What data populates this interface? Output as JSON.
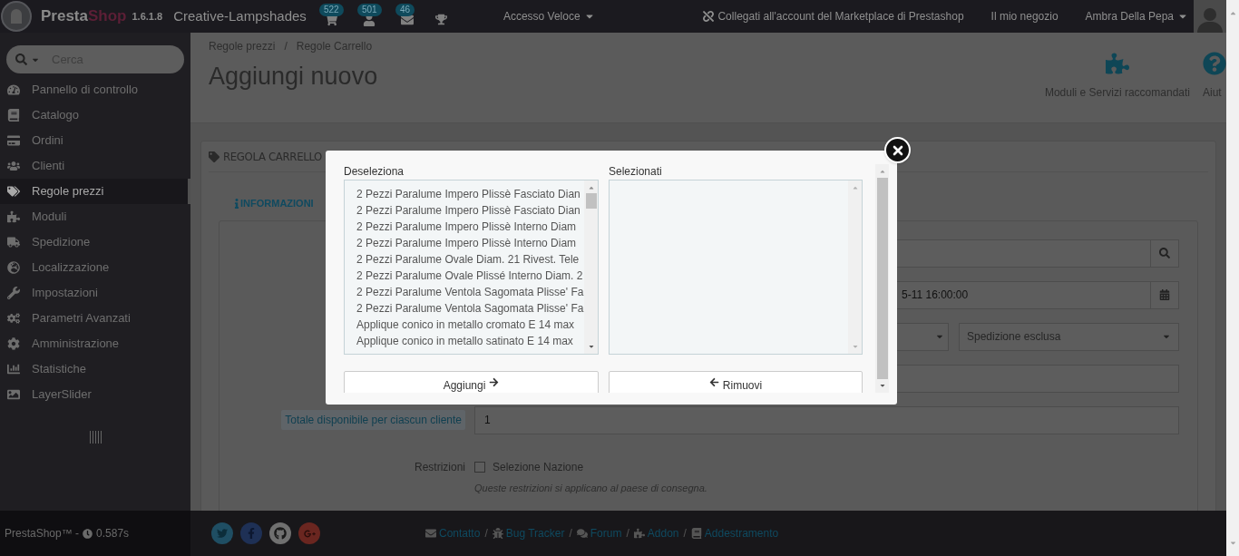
{
  "topbar": {
    "brand_first": "Presta",
    "brand_second": "Shop",
    "version": "1.6.1.8",
    "shop_name": "Creative-Lampshades",
    "notifications": [
      {
        "count": "522"
      },
      {
        "count": "501"
      },
      {
        "count": "46"
      }
    ],
    "quick_access": "Accesso Veloce",
    "marketplace": "Collegati all'account del Marketplace di Prestashop",
    "my_shop": "Il mio negozio",
    "employee": "Ambra Della Pepa"
  },
  "sidebar": {
    "search_placeholder": "Cerca",
    "items": [
      {
        "label": "Pannello di controllo",
        "selected": false
      },
      {
        "label": "Catalogo",
        "selected": false
      },
      {
        "label": "Ordini",
        "selected": false
      },
      {
        "label": "Clienti",
        "selected": false
      },
      {
        "label": "Regole prezzi",
        "selected": true
      },
      {
        "label": "Moduli",
        "selected": false
      },
      {
        "label": "Spedizione",
        "selected": false
      },
      {
        "label": "Localizzazione",
        "selected": false
      },
      {
        "label": "Impostazioni",
        "selected": false
      },
      {
        "label": "Parametri Avanzati",
        "selected": false
      },
      {
        "label": "Amministrazione",
        "selected": false
      },
      {
        "label": "Statistiche",
        "selected": false
      },
      {
        "label": "LayerSlider",
        "selected": false
      }
    ]
  },
  "header": {
    "breadcrumb": [
      "Regole prezzi",
      "Regole Carrello"
    ],
    "breadcrumb_separator": "/",
    "title": "Aggiungi nuovo",
    "toolbar": [
      {
        "label": "Moduli e Servizi raccomandati"
      },
      {
        "label": "Aiut"
      }
    ]
  },
  "panel": {
    "heading": "REGOLA CARRELLO",
    "tab": "INFORMAZIONI",
    "date_value": "5-11 16:00:00",
    "shipping_select": "Spedizione esclusa",
    "quantity_label": "Totale disponibile per ciascun cliente",
    "quantity_value": "1",
    "restrictions_label": "Restrizioni",
    "country_checkbox": {
      "label": "Selezione Nazione",
      "checked": false
    },
    "restrictions_help": "Queste restrizioni si applicano al paese di consegna."
  },
  "modal": {
    "available_label": "Deseleziona",
    "selected_label": "Selezionati",
    "available_items": [
      "2 Pezzi Paralume Impero Plissè Fasciato Dian",
      "2 Pezzi Paralume Impero Plissè Fasciato Dian",
      "2 Pezzi Paralume Impero Plissè Interno Diam",
      "2 Pezzi Paralume Impero Plissè Interno Diam",
      "2 Pezzi Paralume Ovale Diam. 21 Rivest. Tele",
      "2 Pezzi Paralume Ovale Plissé Interno Diam. 2",
      "2 Pezzi Paralume Ventola Sagomata Plisse' Fa",
      "2 Pezzi Paralume Ventola Sagomata Plisse' Fa",
      "Applique conico in metallo cromato E 14 max",
      "Applique conico in metallo satinato E 14 max"
    ],
    "add_button": "Aggiungi",
    "remove_button": "Rimuovi"
  },
  "footer": {
    "version": "PrestaShop™ -",
    "time": "0.587s",
    "links": [
      {
        "label": "Contatto"
      },
      {
        "label": "Bug Tracker"
      },
      {
        "label": "Forum"
      },
      {
        "label": "Addon"
      },
      {
        "label": "Addestramento"
      }
    ],
    "separator": "/"
  }
}
